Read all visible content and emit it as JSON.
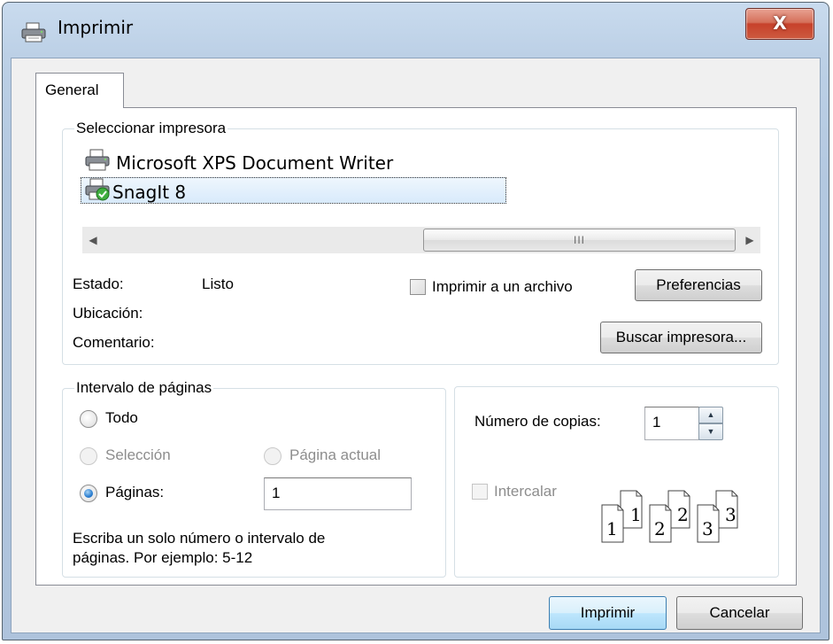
{
  "window": {
    "title": "Imprimir",
    "close_glyph": "X"
  },
  "tabs": [
    {
      "label": "General"
    }
  ],
  "select_printer": {
    "legend": "Seleccionar impresora",
    "printers": [
      {
        "name": "Microsoft XPS Document Writer",
        "icon": "printer-icon",
        "selected": false
      },
      {
        "name": "SnagIt 8",
        "icon": "printer-default-check-icon",
        "selected": true
      }
    ],
    "scrollbar": {
      "thumb_grip": "III"
    },
    "status_label": "Estado:",
    "status_value": "Listo",
    "location_label": "Ubicación:",
    "comment_label": "Comentario:",
    "print_to_file_label": "Imprimir a un archivo",
    "print_to_file_checked": false,
    "preferences_button": "Preferencias",
    "find_printer_button": "Buscar impresora..."
  },
  "page_range": {
    "legend": "Intervalo de páginas",
    "all_label": "Todo",
    "selection_label": "Selección",
    "current_page_label": "Página actual",
    "pages_label": "Páginas:",
    "pages_value": "1",
    "selected_option": "pages",
    "help_line1": "Escriba un solo número o intervalo de",
    "help_line2": "páginas. Por ejemplo: 5-12"
  },
  "copies": {
    "count_label": "Número de copias:",
    "count_value": "1",
    "collate_label": "Intercalar",
    "collate_checked": false,
    "collate_pages": [
      {
        "back": "1",
        "front": "1"
      },
      {
        "back": "2",
        "front": "2"
      },
      {
        "back": "3",
        "front": "3"
      }
    ]
  },
  "footer": {
    "print_button": "Imprimir",
    "cancel_button": "Cancelar"
  },
  "colors": {
    "title_bar": "#bcd0e6",
    "close_button": "#c7412b",
    "default_button_border": "#3c7fb1"
  }
}
